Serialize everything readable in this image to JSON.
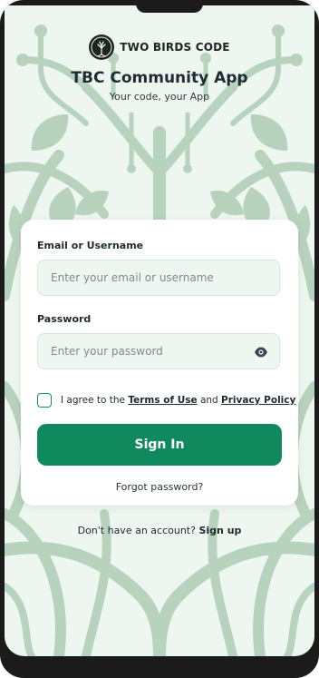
{
  "brand": {
    "logo_icon": "tree-of-life-icon",
    "name": "TWO BIRDS CODE"
  },
  "app": {
    "title": "TBC Community App",
    "subtitle": "Your code, your App"
  },
  "form": {
    "email_label": "Email or Username",
    "email_placeholder": "Enter your email or username",
    "password_label": "Password",
    "password_placeholder": "Enter your password",
    "password_toggle_icon": "eye-icon",
    "agree_prefix": "I agree to the",
    "terms_link": "Terms of Use",
    "agree_and": "and",
    "privacy_link": "Privacy Policy",
    "agree_checked": false,
    "signin_label": "Sign In",
    "forgot_label": "Forgot password?"
  },
  "footer": {
    "no_account": "Don't have an account?",
    "signup_label": "Sign up"
  },
  "colors": {
    "accent": "#11895f",
    "background": "#eef6f0",
    "tree": "#b9d4bf"
  }
}
